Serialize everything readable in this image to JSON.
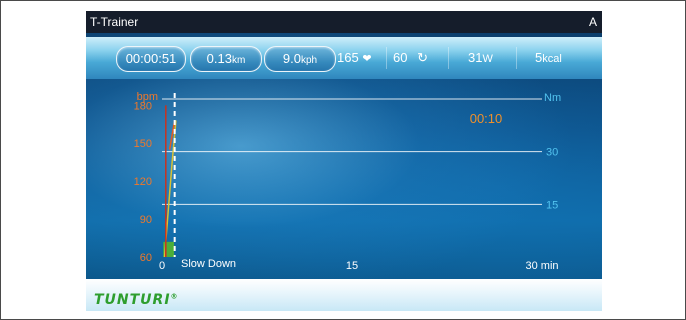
{
  "window": {
    "title": "T-Trainer",
    "corner_label": "A"
  },
  "stats": {
    "time": "00:00:51",
    "distance_value": "0.13",
    "distance_unit": "km",
    "speed_value": "9.0",
    "speed_unit": "kph",
    "heart_rate": "165",
    "cadence": "60",
    "power_value": "31",
    "power_unit": "W",
    "energy_value": "5",
    "energy_unit": "kcal"
  },
  "chart_data": {
    "type": "line",
    "left_axis_label": "bpm",
    "right_axis_label": "Nm",
    "x_unit": "min",
    "x_ticks": [
      "0",
      "15",
      "30"
    ],
    "xlim": [
      0,
      30
    ],
    "left_ticks": [
      "180",
      "150",
      "120",
      "90",
      "60"
    ],
    "ylim_left": [
      60,
      185
    ],
    "right_ticks": [
      "30",
      "15"
    ],
    "ylim_right": [
      0,
      45
    ],
    "timer": "00:10",
    "status_text": "Slow Down",
    "current_position_min": 1.0,
    "series": [
      {
        "color": "#d9c234",
        "x": [
          0.2,
          0.8,
          1.1
        ],
        "y": [
          60,
          135,
          168
        ]
      },
      {
        "color": "#e85a1e",
        "x": [
          0.6,
          1.0
        ],
        "y": [
          145,
          168
        ]
      },
      {
        "color": "#c8321e",
        "x": [
          0.3,
          0.3
        ],
        "y": [
          60,
          180
        ]
      }
    ],
    "bar": {
      "color": "#4caf3a",
      "x_start": 0.1,
      "x_end": 0.95,
      "y_top": 72
    },
    "grid": true
  },
  "colors": {
    "left_axis": "#f0782a",
    "right_axis": "#52c3ef",
    "logo": "#2e9e2e"
  },
  "branding": {
    "logo": "TUNTURI"
  }
}
